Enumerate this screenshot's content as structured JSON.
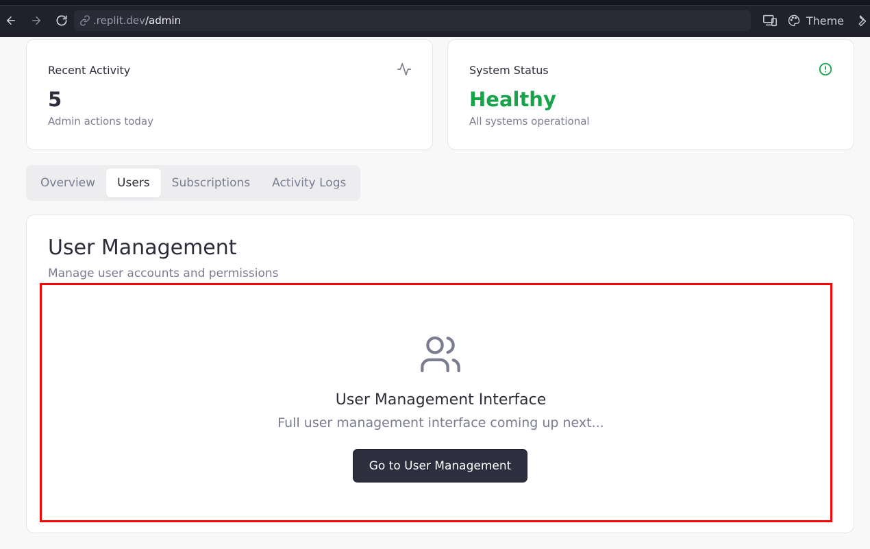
{
  "browser": {
    "url_domain": ".replit.dev",
    "url_path": "/admin",
    "theme_label": "Theme"
  },
  "stats": [
    {
      "title": "Recent Activity",
      "value": "5",
      "subtitle": "Admin actions today",
      "icon": "activity-icon"
    },
    {
      "title": "System Status",
      "value": "Healthy",
      "subtitle": "All systems operational",
      "icon": "alert-circle-icon",
      "value_color": "#16a34a"
    }
  ],
  "tabs": [
    {
      "label": "Overview",
      "active": false
    },
    {
      "label": "Users",
      "active": true
    },
    {
      "label": "Subscriptions",
      "active": false
    },
    {
      "label": "Activity Logs",
      "active": false
    }
  ],
  "user_management": {
    "title": "User Management",
    "subtitle": "Manage user accounts and permissions",
    "icon": "users-icon",
    "empty_title": "User Management Interface",
    "empty_subtitle": "Full user management interface coming up next...",
    "button_label": "Go to User Management"
  },
  "colors": {
    "healthy": "#16a34a",
    "primary_button": "#2d2e3e",
    "highlight_border": "#ff0000"
  }
}
